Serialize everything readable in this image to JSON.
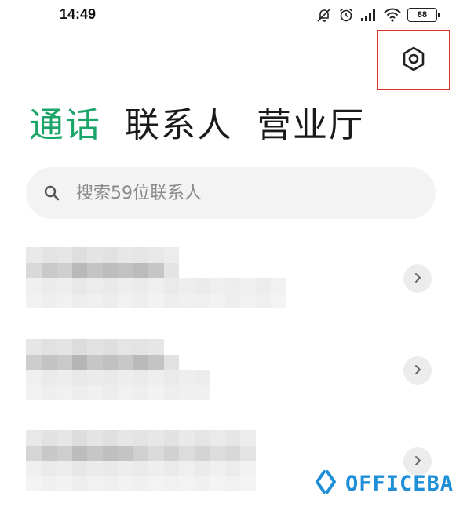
{
  "status_bar": {
    "time": "14:49",
    "battery": "88",
    "icons": [
      "mute-bell-icon",
      "alarm-icon",
      "signal-icon",
      "wifi-icon",
      "battery-icon"
    ]
  },
  "header": {
    "settings_icon": "hexagon-settings-icon"
  },
  "tabs": [
    {
      "label": "通话",
      "active": true
    },
    {
      "label": "联系人",
      "active": false
    },
    {
      "label": "营业厅",
      "active": false
    }
  ],
  "search": {
    "placeholder": "搜索59位联系人"
  },
  "colors": {
    "accent": "#1aa568",
    "highlight_box": "#d9302a",
    "watermark": "#1f8fd8"
  },
  "contacts": [
    {
      "obscured": true
    },
    {
      "obscured": true
    },
    {
      "obscured": true
    }
  ],
  "watermark": {
    "text": "OFFICEBA"
  }
}
